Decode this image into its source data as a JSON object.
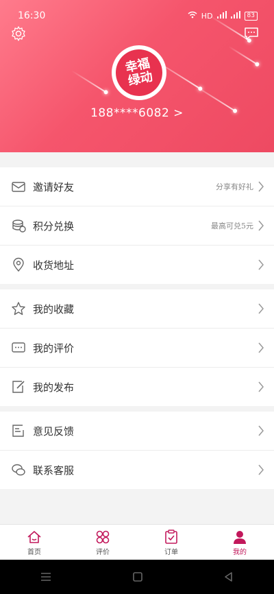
{
  "status_bar": {
    "time": "16:30",
    "network": "HD",
    "battery": "83"
  },
  "header": {
    "logo_line1": "幸福",
    "logo_line2": "绿动",
    "phone": "188****6082 >"
  },
  "menu_groups": [
    [
      {
        "label": "邀请好友",
        "extra": "分享有好礼",
        "icon": "envelope-icon"
      },
      {
        "label": "积分兑换",
        "extra": "最高可兑5元",
        "icon": "coins-icon"
      },
      {
        "label": "收货地址",
        "extra": "",
        "icon": "location-icon"
      }
    ],
    [
      {
        "label": "我的收藏",
        "extra": "",
        "icon": "star-icon"
      },
      {
        "label": "我的评价",
        "extra": "",
        "icon": "comment-icon"
      },
      {
        "label": "我的发布",
        "extra": "",
        "icon": "edit-icon"
      }
    ],
    [
      {
        "label": "意见反馈",
        "extra": "",
        "icon": "feedback-icon"
      },
      {
        "label": "联系客服",
        "extra": "",
        "icon": "chat-icon"
      }
    ]
  ],
  "tabs": [
    {
      "label": "首页",
      "icon": "home-icon",
      "active": false
    },
    {
      "label": "评价",
      "icon": "grid-icon",
      "active": false
    },
    {
      "label": "订单",
      "icon": "clipboard-icon",
      "active": false
    },
    {
      "label": "我的",
      "icon": "user-icon",
      "active": true
    }
  ],
  "colors": {
    "accent": "#c2185b",
    "header_start": "#ff7b8c",
    "header_end": "#ee4a62"
  }
}
